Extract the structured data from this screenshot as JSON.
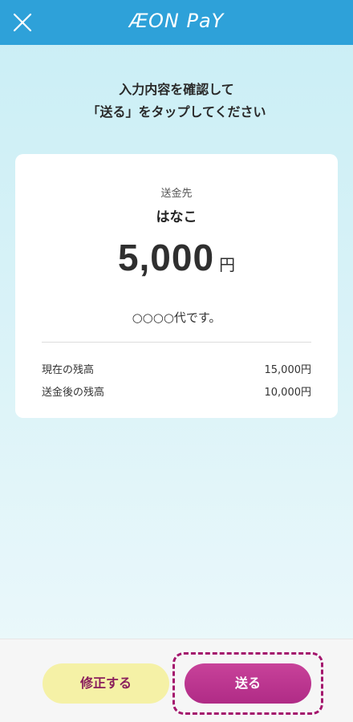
{
  "header": {
    "logo_text": "ÆON PaY"
  },
  "instruction": {
    "line1": "入力内容を確認して",
    "line2": "「送る」をタップしてください"
  },
  "card": {
    "recipient_label": "送金先",
    "recipient_name": "はなこ",
    "amount": "5,000",
    "amount_unit": "円",
    "message": "○○○○代です。",
    "balances": [
      {
        "label": "現在の残高",
        "value": "15,000円"
      },
      {
        "label": "送金後の残高",
        "value": "10,000円"
      }
    ]
  },
  "footer": {
    "edit_label": "修正する",
    "send_label": "送る"
  },
  "colors": {
    "header": "#2ea1d9",
    "send_button": "#b9338f",
    "edit_button": "#f5f1a6",
    "focus_ring": "#a4166d"
  }
}
